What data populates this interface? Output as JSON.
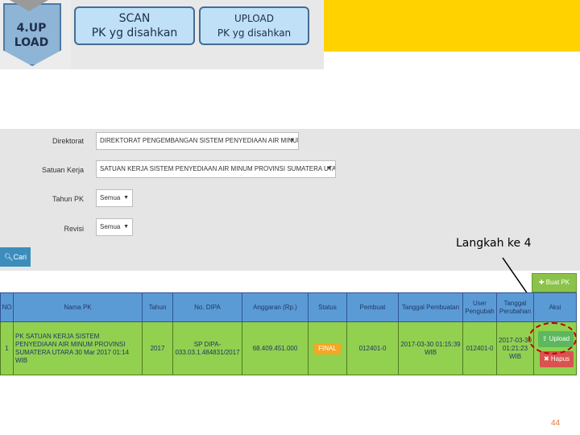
{
  "banner": {
    "step_line1": "4.UP",
    "step_line2": "LOAD",
    "scan_line1": "SCAN",
    "scan_line2": "PK  yg disahkan",
    "upload_line1": "UPLOAD",
    "upload_line2": "PK yg disahkan",
    "accent_yellow": "#ffd200"
  },
  "form": {
    "fields": [
      {
        "label": "Direktorat",
        "value": "DIREKTORAT PENGEMBANGAN SISTEM PENYEDIAAN AIR MINUM"
      },
      {
        "label": "Satuan Kerja",
        "value": "SATUAN KERJA SISTEM PENYEDIAAN AIR MINUM PROVINSI SUMATERA UTARA"
      },
      {
        "label": "Tahun PK",
        "value": "Semua"
      },
      {
        "label": "Revisi",
        "value": "Semua"
      }
    ],
    "cari_label": "Cari",
    "search_icon": "search-icon"
  },
  "annotation": "Langkah ke 4",
  "table": {
    "buat_pk_label": "Buat PK",
    "headers": [
      "NO",
      "Nama PK",
      "Tahun",
      "No. DIPA",
      "Anggaran (Rp.)",
      "Status",
      "Pembuat",
      "Tanggal Pembuatan",
      "User Pengubah",
      "Tanggal Perubahan",
      "Aksi"
    ],
    "rows": [
      {
        "no": "1",
        "nama_pk": "PK SATUAN KERJA SISTEM PENYEDIAAN AIR MINUM PROVINSI SUMATERA UTARA 30 Mar 2017 01:14 WIB",
        "tahun": "2017",
        "no_dipa": "SP DIPA-033.03.1.484831/2017",
        "anggaran": "68.409.451.000",
        "status": "FINAL",
        "pembuat": "012401-0",
        "tanggal_pembuatan": "2017-03-30 01:15:39 WIB",
        "user_pengubah": "012401-0",
        "tanggal_perubahan": "2017-03-30 01:21:23 WIB",
        "aksi_upload": "Upload",
        "aksi_hapus": "Hapus"
      }
    ]
  },
  "page_number": "44"
}
